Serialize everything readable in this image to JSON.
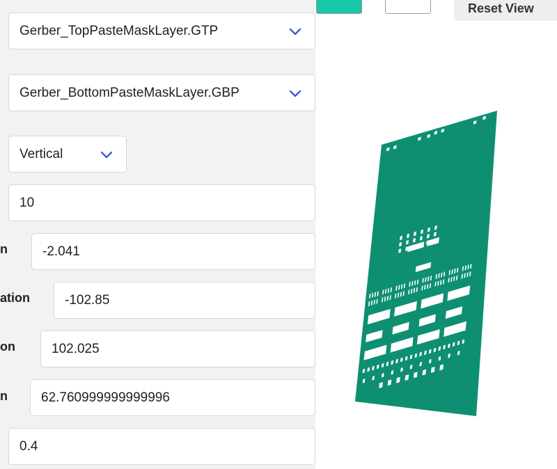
{
  "layers": {
    "top_paste_file": "Gerber_TopPasteMaskLayer.GTP",
    "bottom_paste_file": "Gerber_BottomPasteMaskLayer.GBP"
  },
  "orientation": {
    "selected": "Vertical"
  },
  "params": [
    {
      "label": "",
      "value": "10"
    },
    {
      "label": "n",
      "value": "-2.041"
    },
    {
      "label": "ation",
      "value": "-102.85"
    },
    {
      "label": "on",
      "value": "102.025"
    },
    {
      "label": "n",
      "value": "62.760999999999996"
    },
    {
      "label": "",
      "value": "0.4"
    }
  ],
  "toolbar": {
    "reset_label": "Reset View",
    "color_primary": "#18c7a8",
    "color_secondary": "#ffffff"
  },
  "viewer": {
    "board_color": "#0e8f72",
    "pad_color": "#ffffff"
  },
  "icons": {
    "dropdown": "chevron-down-icon"
  }
}
